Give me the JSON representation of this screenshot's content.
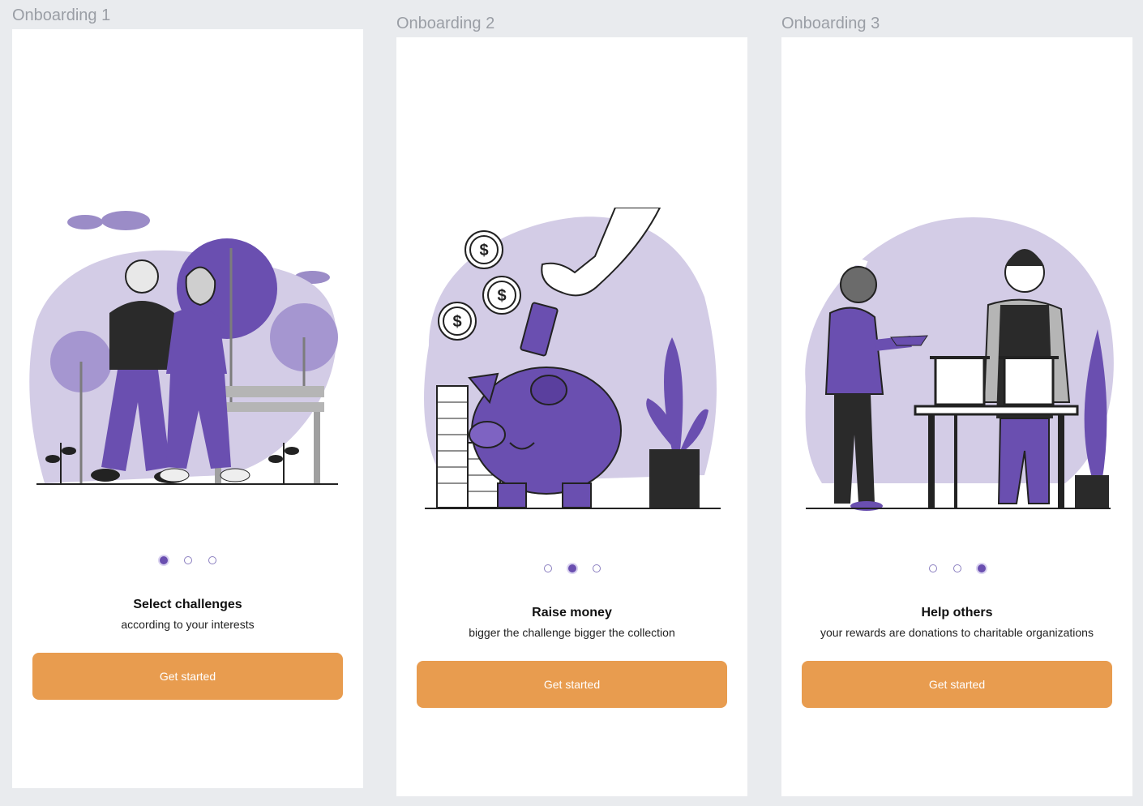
{
  "frames": [
    {
      "label": "Onboarding 1",
      "title": "Select challenges",
      "subtitle": "according to your interests",
      "cta": "Get started",
      "active_dot": 0
    },
    {
      "label": "Onboarding 2",
      "title": "Raise money",
      "subtitle": "bigger the challenge bigger the collection",
      "cta": "Get started",
      "active_dot": 1
    },
    {
      "label": "Onboarding 3",
      "title": "Help others",
      "subtitle": "your rewards are donations to charitable organizations",
      "cta": "Get started",
      "active_dot": 2
    }
  ],
  "colors": {
    "accent_purple": "#6a4fb0",
    "light_purple": "#d3cce6",
    "button_orange": "#e89c4f",
    "canvas_bg": "#e9ebee"
  },
  "illustrations": [
    "couple-walking-illustration",
    "piggy-bank-illustration",
    "food-donation-illustration"
  ]
}
